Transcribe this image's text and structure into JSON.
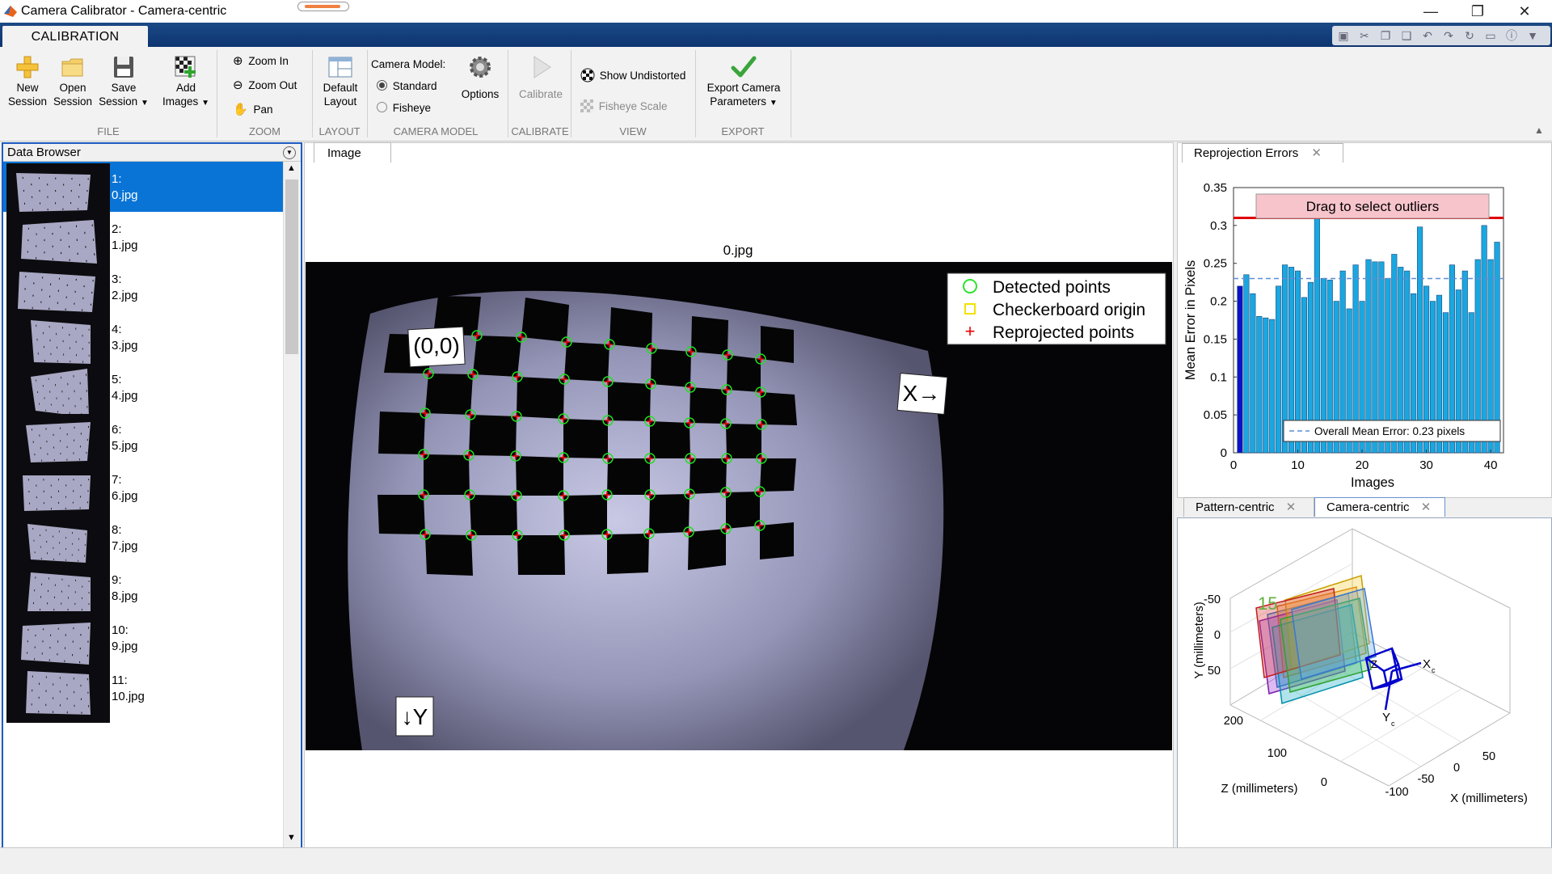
{
  "window": {
    "title": "Camera Calibrator - Camera-centric"
  },
  "ribbon": {
    "tab": "CALIBRATION",
    "file": {
      "new_session": [
        "New",
        "Session"
      ],
      "open_session": [
        "Open",
        "Session"
      ],
      "save_session": [
        "Save",
        "Session"
      ],
      "add_images": [
        "Add",
        "Images"
      ],
      "group": "FILE"
    },
    "zoom": {
      "zoom_in": "Zoom In",
      "zoom_out": "Zoom Out",
      "pan": "Pan",
      "group": "ZOOM"
    },
    "layout": {
      "default_layout": [
        "Default",
        "Layout"
      ],
      "group": "LAYOUT"
    },
    "camera_model": {
      "label": "Camera Model:",
      "standard": "Standard",
      "fisheye": "Fisheye",
      "options": "Options",
      "group": "CAMERA MODEL",
      "selected": "Standard"
    },
    "calibrate": {
      "calibrate": "Calibrate",
      "group": "CALIBRATE"
    },
    "view": {
      "show_undistorted": "Show Undistorted",
      "fisheye_scale": "Fisheye Scale",
      "group": "VIEW"
    },
    "export": {
      "export": [
        "Export Camera",
        "Parameters"
      ],
      "group": "EXPORT"
    }
  },
  "data_browser": {
    "title": "Data Browser",
    "items": [
      {
        "index": "1:",
        "file": "0.jpg",
        "selected": true
      },
      {
        "index": "2:",
        "file": "1.jpg"
      },
      {
        "index": "3:",
        "file": "2.jpg"
      },
      {
        "index": "4:",
        "file": "3.jpg"
      },
      {
        "index": "5:",
        "file": "4.jpg"
      },
      {
        "index": "6:",
        "file": "5.jpg"
      },
      {
        "index": "7:",
        "file": "6.jpg"
      },
      {
        "index": "8:",
        "file": "7.jpg"
      },
      {
        "index": "9:",
        "file": "8.jpg"
      },
      {
        "index": "10:",
        "file": "9.jpg"
      },
      {
        "index": "11:",
        "file": "10.jpg"
      }
    ]
  },
  "image_panel": {
    "tab": "Image",
    "image_title": "0.jpg",
    "origin_label": "(0,0)",
    "x_label": "X→",
    "y_label": "↓Y",
    "legend": {
      "detected": "Detected points",
      "origin": "Checkerboard origin",
      "reprojected": "Reprojected points"
    }
  },
  "reprojection_panel": {
    "tab": "Reprojection Errors",
    "drag_text": "Drag to select outliers",
    "mean_label": "Overall Mean Error: 0.23 pixels"
  },
  "extrinsics_panel": {
    "tabs": [
      "Pattern-centric",
      "Camera-centric"
    ],
    "active_tab": "Camera-centric",
    "y_axis_label": "Y (millimeters)",
    "z_axis_label": "Z (millimeters)",
    "x_axis_label": "X (millimeters)",
    "y_ticks": [
      "-50",
      "0",
      "50"
    ],
    "z_ticks": [
      "200",
      "100",
      "0"
    ],
    "x_ticks": [
      "50",
      "0",
      "-50",
      "-100"
    ],
    "labels": [
      "15"
    ],
    "camera_axes": {
      "z": "Z",
      "x": "X",
      "xsub": "c",
      "y": "Y",
      "ysub": "c"
    }
  },
  "chart_data": {
    "type": "bar",
    "xlabel": "Images",
    "ylabel": "Mean Error in Pixels",
    "xlim": [
      0,
      42
    ],
    "ylim": [
      0,
      0.35
    ],
    "xticks": [
      0,
      10,
      20,
      30,
      40
    ],
    "yticks": [
      0,
      0.05,
      0.1,
      0.15,
      0.2,
      0.25,
      0.3,
      0.35
    ],
    "categories": [
      1,
      2,
      3,
      4,
      5,
      6,
      7,
      8,
      9,
      10,
      11,
      12,
      13,
      14,
      15,
      16,
      17,
      18,
      19,
      20,
      21,
      22,
      23,
      24,
      25,
      26,
      27,
      28,
      29,
      30,
      31,
      32,
      33,
      34,
      35,
      36,
      37,
      38,
      39,
      40,
      41
    ],
    "values": [
      0.22,
      0.235,
      0.21,
      0.18,
      0.178,
      0.176,
      0.22,
      0.248,
      0.245,
      0.24,
      0.205,
      0.225,
      0.31,
      0.23,
      0.228,
      0.2,
      0.24,
      0.19,
      0.248,
      0.2,
      0.255,
      0.252,
      0.252,
      0.23,
      0.262,
      0.245,
      0.24,
      0.21,
      0.298,
      0.22,
      0.2,
      0.208,
      0.185,
      0.248,
      0.215,
      0.24,
      0.185,
      0.255,
      0.3,
      0.255,
      0.278
    ],
    "selected_index": 1,
    "overall_mean": 0.23,
    "outlier_threshold": 0.31,
    "grid": false,
    "colors": {
      "bar": "#1aa7e0",
      "selected": "#0a12c8",
      "threshold": "#e00000",
      "mean_line": "#5b8fd6"
    }
  }
}
